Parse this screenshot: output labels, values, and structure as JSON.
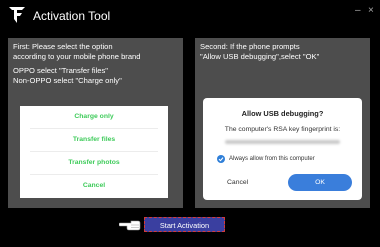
{
  "window": {
    "title": "Activation Tool",
    "minimize_symbol": "–",
    "close_symbol": "×",
    "logo_icon": "brand-logo-icon"
  },
  "left_panel": {
    "line1": "First: Please select the option",
    "line2": "according to your mobile phone brand",
    "line3": "OPPO select \"Transfer files\"",
    "line4": "Non-OPPO select \"Charge only\"",
    "options": [
      "Charge only",
      "Transfer files",
      "Transfer photos",
      "Cancel"
    ],
    "option_color": "#3ecb5a"
  },
  "right_panel": {
    "line1": "Second: If the phone prompts",
    "line2": "\"Allow USB debugging\",select \"OK\"",
    "dialog": {
      "title": "Allow USB debugging?",
      "body": "The computer's RSA key fingerprint is:",
      "checkbox_label": "Always allow from this computer",
      "checkbox_checked": true,
      "cancel_label": "Cancel",
      "ok_label": "OK",
      "ok_color": "#3a7edb"
    }
  },
  "footer": {
    "start_label": "Start Activation",
    "pointer_icon": "pointing-hand-icon"
  }
}
